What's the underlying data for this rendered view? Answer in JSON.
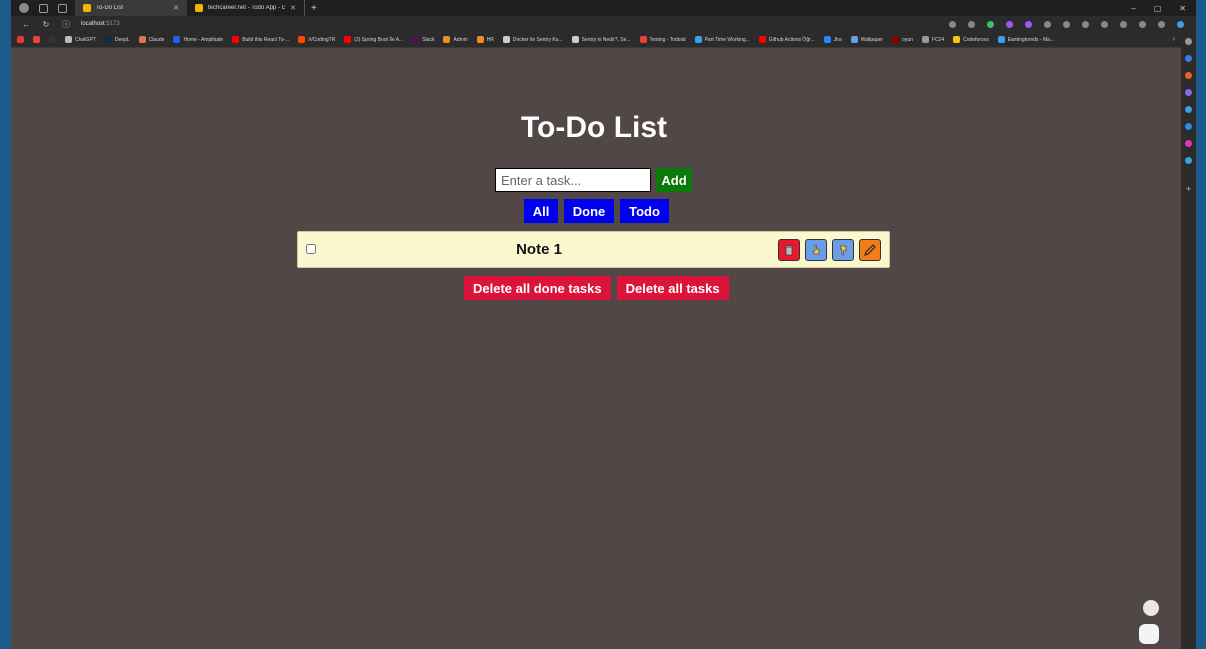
{
  "browser": {
    "tabs": [
      {
        "label": "To-Do List",
        "active": true
      },
      {
        "label": "techcareer.net - Todo App - Goo",
        "active": false
      }
    ],
    "new_tab_glyph": "+",
    "window_controls": [
      "–",
      "▢",
      "✕"
    ],
    "address": {
      "host": "localhost",
      "port": ":5173"
    },
    "bookmarks": [
      {
        "label": "",
        "color": "#e53935"
      },
      {
        "label": "",
        "color": "#ea4335"
      },
      {
        "label": "",
        "color": "#333333"
      },
      {
        "label": "ChatGPT",
        "color": "#bbbbbb"
      },
      {
        "label": "DeepL",
        "color": "#0f2b46"
      },
      {
        "label": "Claude",
        "color": "#d97757"
      },
      {
        "label": "Home - Amplitude",
        "color": "#1e61f0"
      },
      {
        "label": "Build this React To-...",
        "color": "#ff0000"
      },
      {
        "label": "/r/CodingTR",
        "color": "#ff4500"
      },
      {
        "label": "(2) Spring Boot İle A...",
        "color": "#ff0000"
      },
      {
        "label": "Slack",
        "color": "#4a154b"
      },
      {
        "label": "Admin",
        "color": "#f08a24"
      },
      {
        "label": "HR",
        "color": "#f08a24"
      },
      {
        "label": "Docker ile Sentry Ku...",
        "color": "#cccccc"
      },
      {
        "label": "Sentry io Nedir?, Se...",
        "color": "#cccccc"
      },
      {
        "label": "Testing - Todoist",
        "color": "#e44332"
      },
      {
        "label": "Part Time Working...",
        "color": "#3aa0e8"
      },
      {
        "label": "Github Actions Öğr...",
        "color": "#ff0000"
      },
      {
        "label": "Jira",
        "color": "#2684ff"
      },
      {
        "label": "Wallpaper",
        "color": "#6aa0e0"
      },
      {
        "label": "oyun",
        "color": "#8b0000"
      },
      {
        "label": "FC24",
        "color": "#999999"
      },
      {
        "label": "Codeforces",
        "color": "#f5c518"
      },
      {
        "label": "Eamingtrends - Ma...",
        "color": "#3aa0e8"
      }
    ],
    "bookmarks_more": "›"
  },
  "app": {
    "title": "To-Do List",
    "input": {
      "placeholder": "Enter a task...",
      "value": ""
    },
    "add_label": "Add",
    "filters": [
      "All",
      "Done",
      "Todo"
    ],
    "todos": [
      {
        "text": "Note 1",
        "done": false
      }
    ],
    "bulk_actions": {
      "delete_done": "Delete all done tasks",
      "delete_all": "Delete all tasks"
    }
  },
  "colors": {
    "page_bg": "#514747",
    "add": "#0a7a0a",
    "filter": "#0000f0",
    "danger": "#dc143c",
    "todo_bg": "#fbf7cf"
  }
}
